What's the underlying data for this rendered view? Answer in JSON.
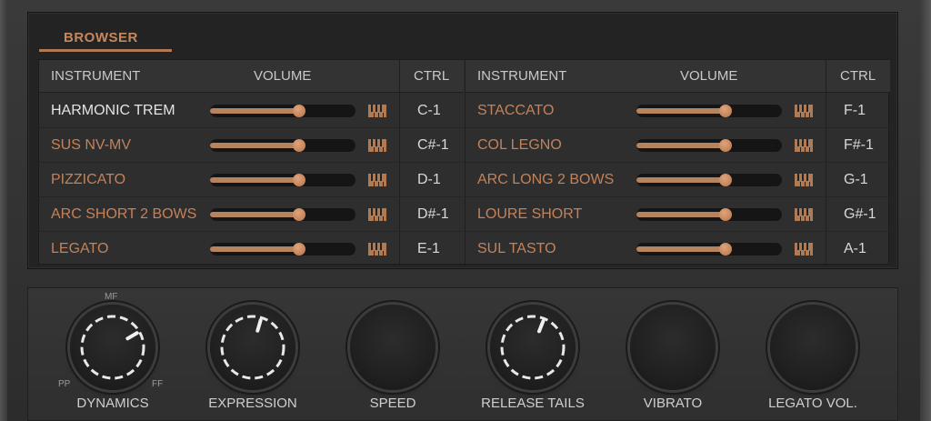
{
  "browser": {
    "tab_label": "BROWSER",
    "headers": {
      "instrument": "INSTRUMENT",
      "volume": "VOLUME",
      "ctrl": "CTRL"
    },
    "left": [
      {
        "name": "HARMONIC TREM",
        "ctrl": "C-1",
        "volume": 0.61,
        "active": true
      },
      {
        "name": "SUS NV-MV",
        "ctrl": "C#-1",
        "volume": 0.61,
        "active": false
      },
      {
        "name": "PIZZICATO",
        "ctrl": "D-1",
        "volume": 0.61,
        "active": false
      },
      {
        "name": "ARC SHORT 2 BOWS",
        "ctrl": "D#-1",
        "volume": 0.61,
        "active": false
      },
      {
        "name": "LEGATO",
        "ctrl": "E-1",
        "volume": 0.61,
        "active": false
      }
    ],
    "right": [
      {
        "name": "STACCATO",
        "ctrl": "F-1",
        "volume": 0.61,
        "active": false
      },
      {
        "name": "COL LEGNO",
        "ctrl": "F#-1",
        "volume": 0.61,
        "active": false
      },
      {
        "name": "ARC LONG 2 BOWS",
        "ctrl": "G-1",
        "volume": 0.61,
        "active": false
      },
      {
        "name": "LOURE SHORT",
        "ctrl": "G#-1",
        "volume": 0.61,
        "active": false
      },
      {
        "name": "SUL TASTO",
        "ctrl": "A-1",
        "volume": 0.61,
        "active": false
      }
    ]
  },
  "knobs": {
    "dynamics": {
      "label": "DYNAMICS",
      "mark_min": "PP",
      "mark_mid": "MF",
      "mark_max": "FF",
      "value": 0.72
    },
    "expression": {
      "label": "EXPRESSION",
      "value": 0.56
    },
    "speed": {
      "label": "SPEED"
    },
    "release_tails": {
      "label": "RELEASE TAILS",
      "value": 0.58
    },
    "vibrato": {
      "label": "VIBRATO"
    },
    "legato_vol": {
      "label": "LEGATO VOL."
    }
  },
  "colors": {
    "accent": "#c4825a",
    "slider_fill": "#b6835f",
    "panel": "#232323"
  }
}
